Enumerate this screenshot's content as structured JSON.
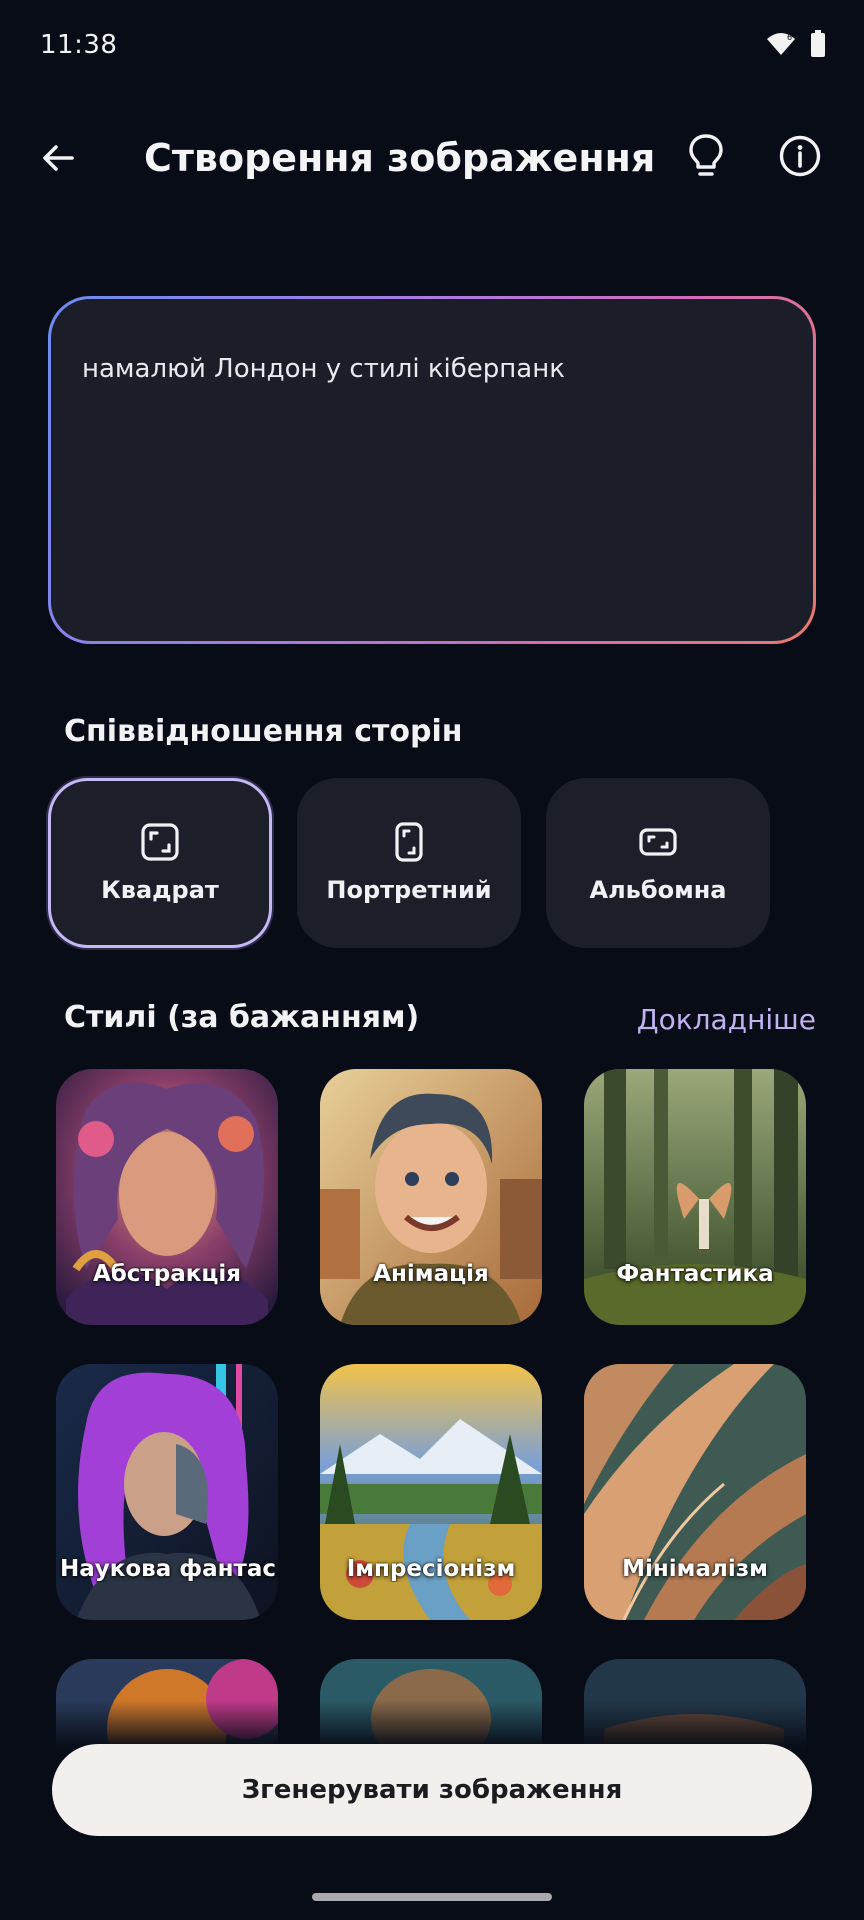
{
  "status_bar": {
    "time": "11:38",
    "icons": [
      "wifi-icon",
      "battery-icon"
    ]
  },
  "app_bar": {
    "title": "Створення зображення",
    "icons": [
      "back-arrow-icon",
      "lightbulb-icon",
      "info-icon"
    ]
  },
  "prompt": {
    "text": "намалюй Лондон у стилі кіберпанк"
  },
  "aspect": {
    "title": "Співвідношення сторін",
    "options": [
      {
        "label": "Квадрат",
        "icon": "square-aspect-icon",
        "selected": true
      },
      {
        "label": "Портретний",
        "icon": "portrait-aspect-icon",
        "selected": false
      },
      {
        "label": "Альбомна",
        "icon": "landscape-aspect-icon",
        "selected": false
      }
    ]
  },
  "styles": {
    "title": "Стилі (за бажанням)",
    "more_link": "Докладніше",
    "items": [
      {
        "label": "Абстракція"
      },
      {
        "label": "Анімація"
      },
      {
        "label": "Фантастика"
      },
      {
        "label": "Наукова фантас.."
      },
      {
        "label": "Імпресіонізм"
      },
      {
        "label": "Мінімалізм"
      }
    ]
  },
  "generate_button": {
    "label": "Згенерувати зображення"
  },
  "colors": {
    "background": "#070c16",
    "card": "#1c1f2a",
    "accent": "#c2b2f0",
    "button": "#f3efec"
  }
}
